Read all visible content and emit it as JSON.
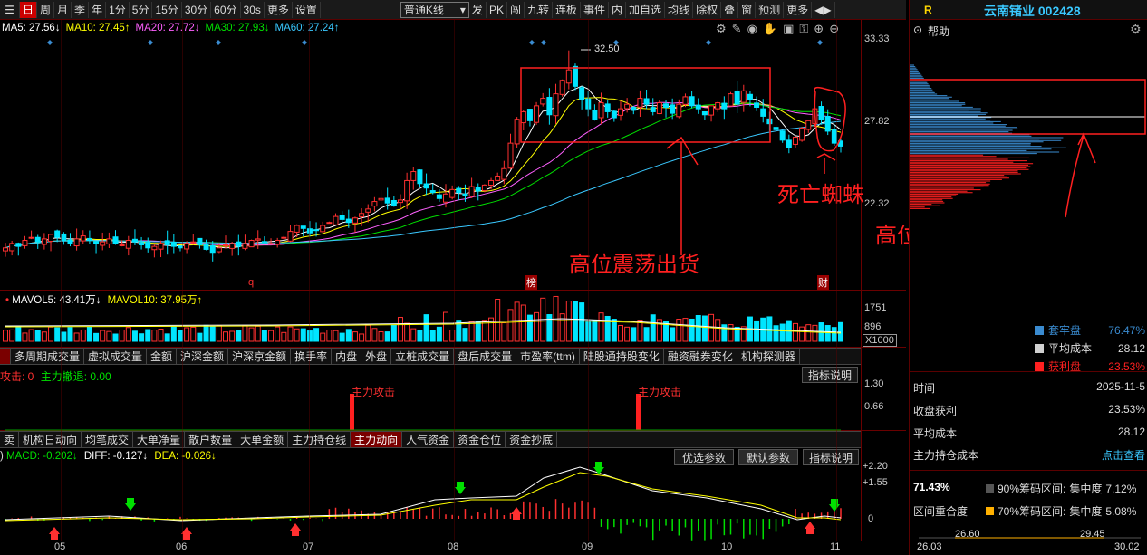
{
  "toolbar": {
    "items": [
      "日",
      "周",
      "月",
      "季",
      "年",
      "1分",
      "5分",
      "15分",
      "30分",
      "60分",
      "30s",
      "更多",
      "设置"
    ],
    "active": "日",
    "kline_select": "普通K线",
    "right_items": [
      "发",
      "PK",
      "闯",
      "九转",
      "连板",
      "事件",
      "内",
      "加自选",
      "均线",
      "除权",
      "叠",
      "窗",
      "预测",
      "更多"
    ]
  },
  "ma_bar": {
    "ma5": "MA5: 27.56↓",
    "ma10": "MA10: 27.45↑",
    "ma20": "MA20: 27.72↓",
    "ma30": "MA30: 27.93↓",
    "ma60": "MA60: 27.24↑"
  },
  "price_axis": {
    "top": "33.33",
    "mid": "27.82",
    "low": "22.32"
  },
  "price_marks": {
    "high_label": "32.50",
    "mark_q": "q",
    "mark_bang": "榜",
    "mark_cai": "财"
  },
  "annotations": {
    "spider": "死亡蜘蛛",
    "shake": "高位震荡出货",
    "pile": "高位堆积大量套牢盘"
  },
  "volume": {
    "mavol5": "MAVOL5: 43.41万↓",
    "mavol10": "MAVOL10: 37.95万↑",
    "axis_top": "1751",
    "axis_mid": "896",
    "axis_unit": "X1000"
  },
  "tabs1": [
    "多周期成交量",
    "虚拟成交量",
    "金额",
    "沪深金额",
    "沪深京金额",
    "换手率",
    "内盘",
    "外盘",
    "立桩成交量",
    "盘后成交量",
    "市盈率(ttm)",
    "陆股通持股变化",
    "融资融券变化",
    "机构探测器"
  ],
  "main_force": {
    "attack": "攻击: 0",
    "retreat": "主力撤退: 0.00",
    "label1": "主力攻击",
    "label2": "主力攻击",
    "axis_top": "1.30",
    "axis_mid": "0.66",
    "explain": "指标说明"
  },
  "tabs2": [
    "卖",
    "机构日动向",
    "均笔成交",
    "大单净量",
    "散户数量",
    "大单金额",
    "主力持仓线",
    "主力动向",
    "人气资金",
    "资金仓位",
    "资金抄底"
  ],
  "tabs2_active": "主力动向",
  "macd": {
    "macd": "MACD: -0.202↓",
    "diff": "DIFF: -0.127↓",
    "dea": "DEA: -0.026↓",
    "btn_opt": "优选参数",
    "btn_def": "默认参数",
    "btn_explain": "指标说明",
    "axis_top": "+2.20",
    "axis_mid": "+1.55",
    "axis_zero": "0"
  },
  "dates": [
    "05",
    "06",
    "07",
    "08",
    "09",
    "10",
    "11"
  ],
  "right": {
    "r": "R",
    "stock": "云南锗业 002428",
    "help": "帮助",
    "legend": [
      {
        "name": "套牢盘",
        "value": "76.47%",
        "color": "#3a8bd0"
      },
      {
        "name": "平均成本",
        "value": "28.12",
        "color": "#d0d0d0"
      },
      {
        "name": "获利盘",
        "value": "23.53%",
        "color": "#ff2020"
      }
    ],
    "time_label": "时间",
    "time_value": "2025-11-5",
    "profit_label": "收盘获利",
    "profit_value": "23.53%",
    "cost_label": "平均成本",
    "cost_value": "28.12",
    "holder_label": "主力持仓成本",
    "holder_value": "点击查看",
    "conc": "71.43%",
    "range_label": "区间重合度",
    "r90": "90%筹码区间:",
    "r90v": "集中度",
    "r90p": "7.12%",
    "r70": "70%筹码区间:",
    "r70v": "集中度",
    "r70p": "5.08%",
    "bot_1": "26.03",
    "bot_2": "26.60",
    "bot_3": "29.45",
    "bot_4": "30.02"
  },
  "chart_data": {
    "type": "candlestick",
    "series": [
      {
        "name": "MA5",
        "color": "#ffffff"
      },
      {
        "name": "MA10",
        "color": "#ffff00"
      },
      {
        "name": "MA20",
        "color": "#ff60ff"
      },
      {
        "name": "MA30",
        "color": "#00e000"
      },
      {
        "name": "MA60",
        "color": "#3ac8ff"
      }
    ],
    "close": [
      19.3,
      19.6,
      19.4,
      19.8,
      20.0,
      19.7,
      19.9,
      20.2,
      20.0,
      19.8,
      19.6,
      19.9,
      20.1,
      19.8,
      19.6,
      19.7,
      19.9,
      19.6,
      19.5,
      19.8,
      19.7,
      19.5,
      19.3,
      19.4,
      19.6,
      19.5,
      19.4,
      19.3,
      19.6,
      19.7,
      19.5,
      19.2,
      19.0,
      19.3,
      19.5,
      19.6,
      19.4,
      19.6,
      19.8,
      19.9,
      19.7,
      19.6,
      19.8,
      20.0,
      20.4,
      20.8,
      20.6,
      20.3,
      20.5,
      20.8,
      21.0,
      21.4,
      21.2,
      21.0,
      21.3,
      21.6,
      21.9,
      22.4,
      22.6,
      22.3,
      22.1,
      22.5,
      23.8,
      24.4,
      23.6,
      23.3,
      23.0,
      22.6,
      22.9,
      23.2,
      23.0,
      22.8,
      23.4,
      23.1,
      23.5,
      23.8,
      24.1,
      24.6,
      26.3,
      27.9,
      28.4,
      27.8,
      28.8,
      29.3,
      28.2,
      29.6,
      30.5,
      31.2,
      30.1,
      29.2,
      28.6,
      27.9,
      29.0,
      28.4,
      28.0,
      28.6,
      28.9,
      28.5,
      29.3,
      28.9,
      28.4,
      29.0,
      28.7,
      28.3,
      28.9,
      29.4,
      28.8,
      28.6,
      28.2,
      28.8,
      29.0,
      28.6,
      29.6,
      28.9,
      29.8,
      29.2,
      28.7,
      28.1,
      27.6,
      27.2,
      26.5,
      26.0,
      26.7,
      27.3,
      27.8,
      28.6,
      27.9,
      27.1,
      26.3,
      26.1
    ],
    "ylim": [
      18.5,
      33.33
    ],
    "dates": [
      "05",
      "06",
      "07",
      "08",
      "09",
      "10",
      "11"
    ]
  }
}
